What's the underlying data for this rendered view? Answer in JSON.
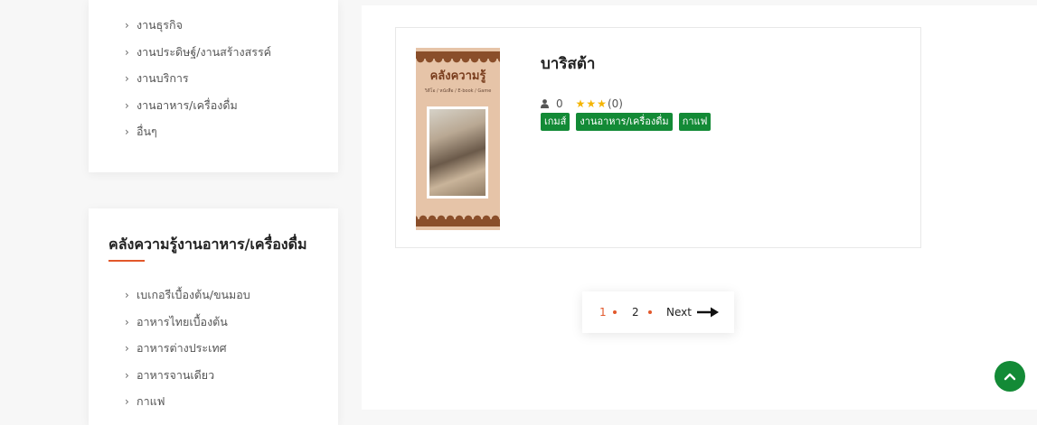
{
  "sidebar_top": {
    "items": [
      "งานธุรกิจ",
      "งานประดิษฐ์/งานสร้างสรรค์",
      "งานบริการ",
      "งานอาหาร/เครื่องดื่ม",
      "อื่นๆ"
    ]
  },
  "sidebar_food": {
    "title": "คลังความรู้งานอาหาร/เครื่องดื่ม",
    "items": [
      "เบเกอรีเบื้องต้น/ขนมอบ",
      "อาหารไทยเบื้องต้น",
      "อาหารต่างประเทศ",
      "อาหารจานเดียว",
      "กาแฟ"
    ]
  },
  "book": {
    "title": "บาริสต้า",
    "cover_title": "คลังความรู้",
    "cover_subtitle": "วิดีโอ / หนังสือ / E-book / Game",
    "views": "0",
    "rating_count": "(0)",
    "stars": 3,
    "tags": [
      "เกมส์",
      "งานอาหาร/เครื่องดื่ม",
      "กาแฟ"
    ]
  },
  "pagination": {
    "current": "1",
    "next_page": "2",
    "next_label": "Next"
  },
  "colors": {
    "accent": "#e2582b",
    "tag_green": "#138a36",
    "star": "#f4b400"
  }
}
